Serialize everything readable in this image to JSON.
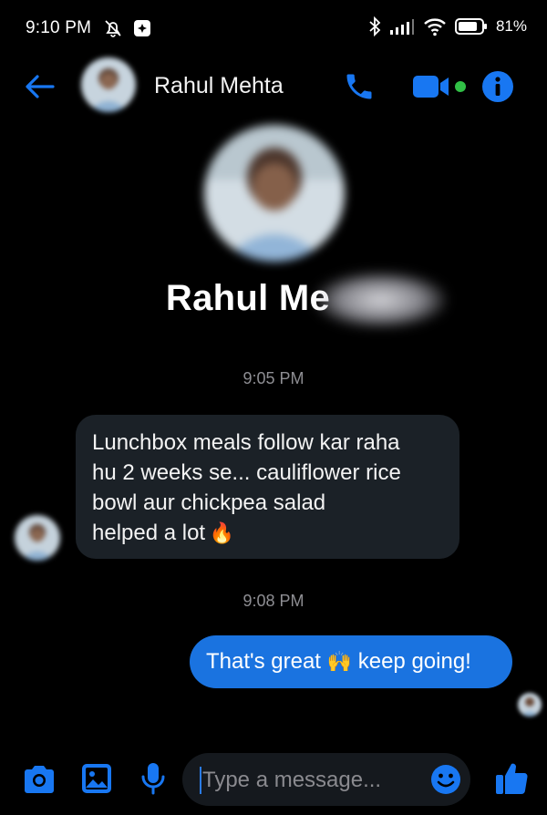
{
  "status_bar": {
    "time": "9:10 PM",
    "battery": "81%",
    "icons": [
      "mute-vibrate-icon",
      "app-notification-icon",
      "bluetooth-icon",
      "signal-icon",
      "wifi-icon",
      "battery-icon"
    ]
  },
  "header": {
    "contact_name": "Rahul Mehta",
    "icons": [
      "back-arrow-icon",
      "phone-icon",
      "video-camera-icon",
      "info-icon"
    ],
    "accent_color": "#1877f2",
    "active_color": "#31c046"
  },
  "profile": {
    "name": "Rahul Me"
  },
  "messages": [
    {
      "timestamp": "9:05 PM",
      "direction": "received",
      "text": "Lunchbox meals follow kar raha\nhu 2 weeks se... cauliflower rice\nbowl aur chickpea salad\nhelped a lot",
      "emoji": "🔥",
      "bubble_color": "#1b2127"
    },
    {
      "timestamp": "9:08 PM",
      "direction": "sent",
      "text_before": "That's great ",
      "emoji": "🙌",
      "text_after": " keep going!",
      "bubble_color": "#1a73e0"
    }
  ],
  "composer": {
    "placeholder": "Type a message...",
    "icons": [
      "camera-icon",
      "gallery-icon",
      "microphone-icon",
      "emoji-icon",
      "thumbs-up-icon"
    ]
  }
}
